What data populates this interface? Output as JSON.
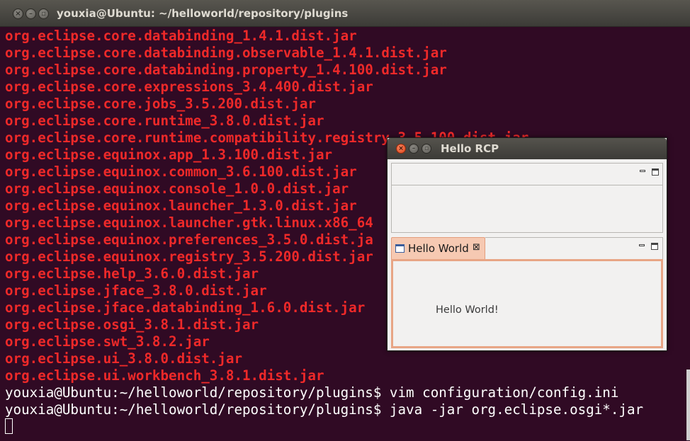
{
  "terminal": {
    "title": "youxia@Ubuntu: ~/helloworld/repository/plugins",
    "close_glyph": "×",
    "min_glyph": "–",
    "max_glyph": "▫",
    "lines": [
      "org.eclipse.core.databinding_1.4.1.dist.jar",
      "org.eclipse.core.databinding.observable_1.4.1.dist.jar",
      "org.eclipse.core.databinding.property_1.4.100.dist.jar",
      "org.eclipse.core.expressions_3.4.400.dist.jar",
      "org.eclipse.core.jobs_3.5.200.dist.jar",
      "org.eclipse.core.runtime_3.8.0.dist.jar",
      "org.eclipse.core.runtime.compatibility.registry_3.5.100.dist.jar",
      "org.eclipse.equinox.app_1.3.100.dist.jar",
      "org.eclipse.equinox.common_3.6.100.dist.jar",
      "org.eclipse.equinox.console_1.0.0.dist.jar",
      "org.eclipse.equinox.launcher_1.3.0.dist.jar",
      "org.eclipse.equinox.launcher.gtk.linux.x86_64",
      "org.eclipse.equinox.preferences_3.5.0.dist.ja",
      "org.eclipse.equinox.registry_3.5.200.dist.jar",
      "org.eclipse.help_3.6.0.dist.jar",
      "org.eclipse.jface_3.8.0.dist.jar",
      "org.eclipse.jface.databinding_1.6.0.dist.jar",
      "org.eclipse.osgi_3.8.1.dist.jar",
      "org.eclipse.swt_3.8.2.jar",
      "org.eclipse.ui_3.8.0.dist.jar",
      "org.eclipse.ui.workbench_3.8.1.dist.jar"
    ],
    "commands": [
      "youxia@Ubuntu:~/helloworld/repository/plugins$ vim configuration/config.ini",
      "youxia@Ubuntu:~/helloworld/repository/plugins$ java -jar org.eclipse.osgi*.jar"
    ],
    "colors": {
      "background": "#300a24",
      "jar_text": "#ef2929",
      "prompt_text": "#ffffff"
    }
  },
  "rcp_window": {
    "title": "Hello RCP",
    "close_glyph": "×",
    "min_glyph": "–",
    "max_glyph": "▫",
    "tab_label": "Hello World",
    "tab_close_glyph": "⊠",
    "content_text": "Hello World!",
    "colors": {
      "active_tab": "#f6c9b2",
      "active_border": "#e8a585"
    }
  }
}
